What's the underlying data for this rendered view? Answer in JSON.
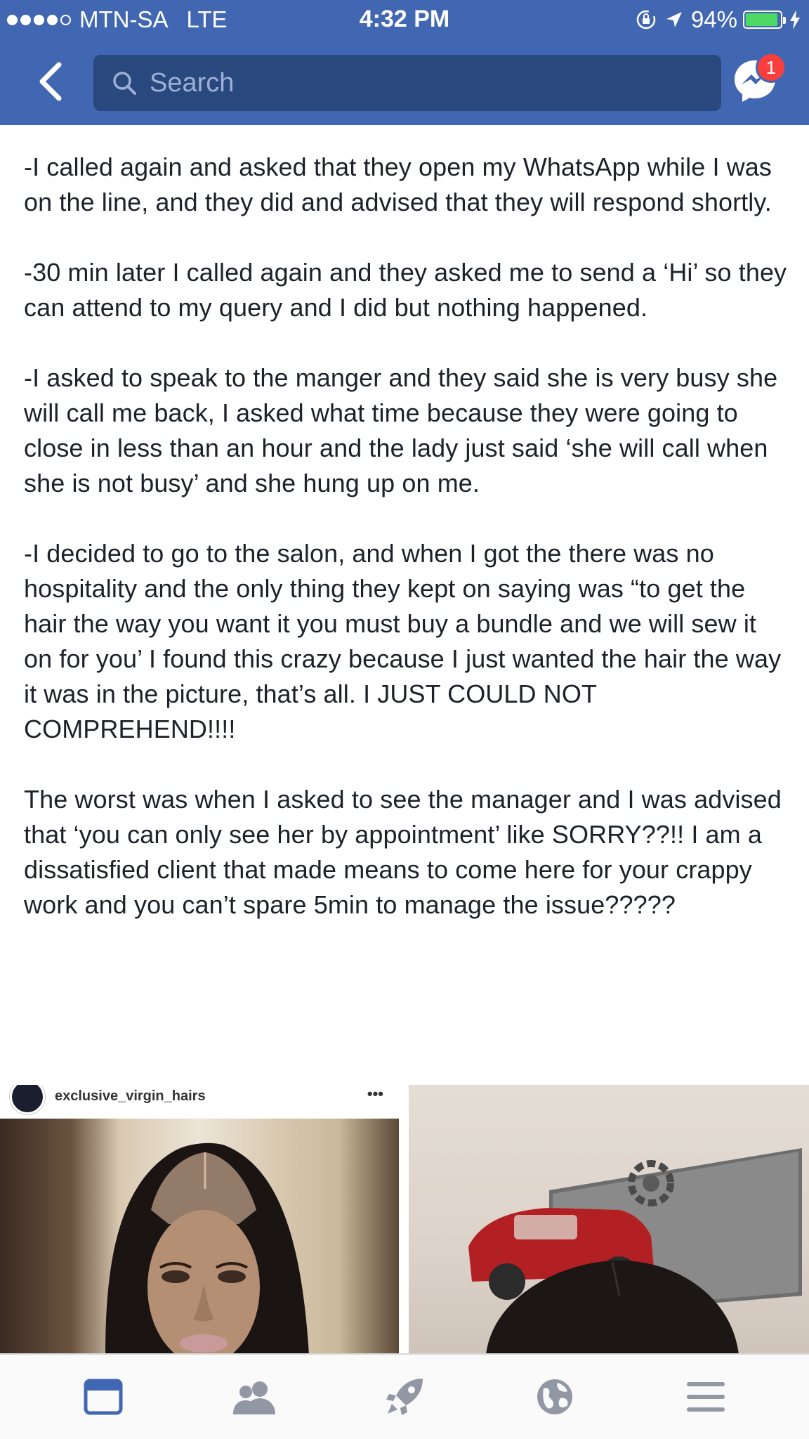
{
  "status_bar": {
    "carrier": "MTN-SA",
    "network": "LTE",
    "time": "4:32 PM",
    "battery": "94%",
    "battery_level": 0.94,
    "signal_bars": 4,
    "signal_max": 5
  },
  "nav": {
    "search_placeholder": "Search",
    "messenger_badge": "1"
  },
  "post": {
    "paragraphs": [
      "-I called again and asked that they open my WhatsApp while I was on the line, and they did and advised that they will respond shortly.",
      "-30 min later I called again and they asked me to send a ‘Hi’ so they can attend to my query and I did but nothing happened.",
      "-I asked to speak to the manger and they said she is very busy she will call me back, I asked what time because they were going to close in less than an hour and the lady just said ‘she will call when she is not busy’ and she hung up on me.",
      "-I decided to go to the salon, and when I got the there was no hospitality and the only thing they kept on saying was “to get the hair the way you want it you must buy a bundle and we will sew it on for you’ I found this crazy because I just wanted the hair the way it was in the picture, that’s all. I JUST COULD NOT COMPREHEND!!!!",
      "The worst was when I asked to see the manager and I was advised that ‘you can only see her by appointment’ like SORRY??!! I am a dissatisfied client that made means to come here for your crappy work and you can’t spare 5min to manage the issue?????"
    ]
  },
  "photos": {
    "left_username": "exclusive_virgin_hairs",
    "left_more": "•••"
  },
  "tab_bar": {
    "tabs": [
      "news-feed-icon",
      "friends-icon",
      "explore-icon",
      "notifications-globe-icon",
      "menu-icon"
    ],
    "active_color": "#4267b2",
    "inactive_color": "#9197a3"
  },
  "colors": {
    "brand": "#4267b2",
    "search_bg": "#29487d",
    "badge": "#fa3e3e",
    "battery": "#4cd964"
  }
}
